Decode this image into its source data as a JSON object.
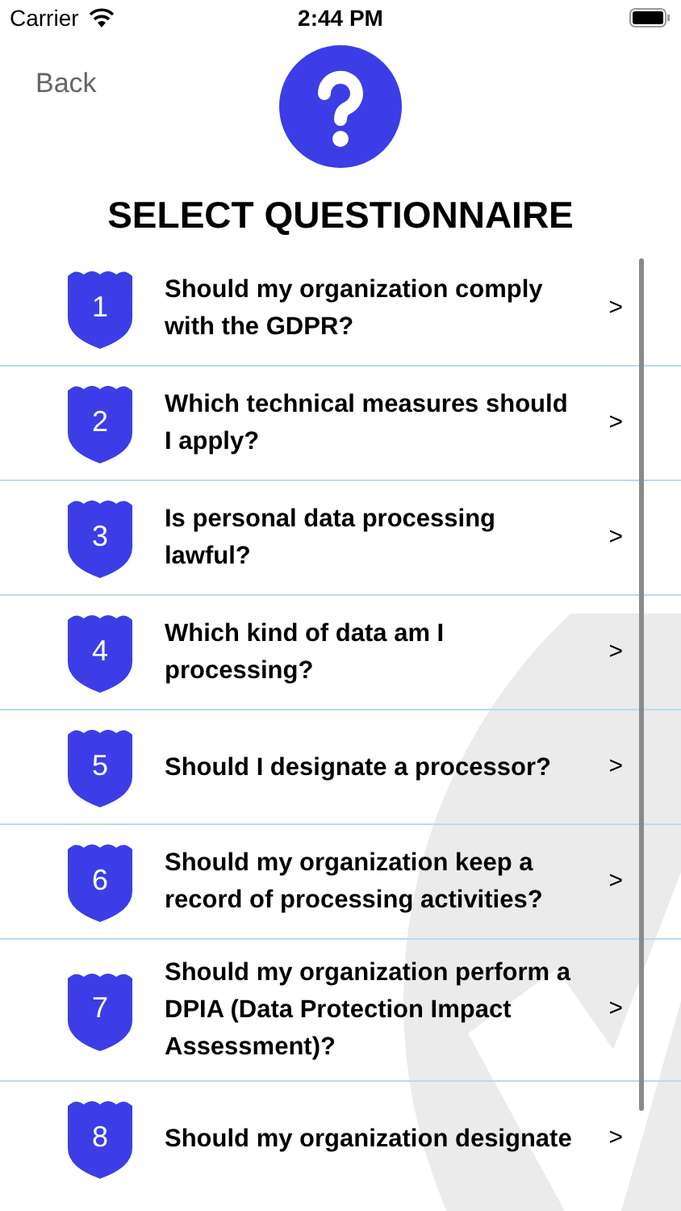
{
  "status_bar": {
    "carrier": "Carrier",
    "time": "2:44 PM"
  },
  "nav": {
    "back": "Back"
  },
  "title": "SELECT QUESTIONNAIRE",
  "questionnaires": [
    {
      "number": "1",
      "text": "Should my organization comply with the GDPR?",
      "chevron": ">"
    },
    {
      "number": "2",
      "text": "Which technical measures should I apply?",
      "chevron": ">"
    },
    {
      "number": "3",
      "text": "Is personal data processing lawful?",
      "chevron": ">"
    },
    {
      "number": "4",
      "text": "Which kind of data am I processing?",
      "chevron": ">"
    },
    {
      "number": "5",
      "text": "Should I designate a processor?",
      "chevron": ">"
    },
    {
      "number": "6",
      "text": "Should my organization keep a record of processing activities?",
      "chevron": ">"
    },
    {
      "number": "7",
      "text": "Should my organization perform a DPIA (Data Protection Impact Assessment)?",
      "chevron": ">"
    },
    {
      "number": "8",
      "text": "Should my organization designate",
      "chevron": ">"
    }
  ]
}
